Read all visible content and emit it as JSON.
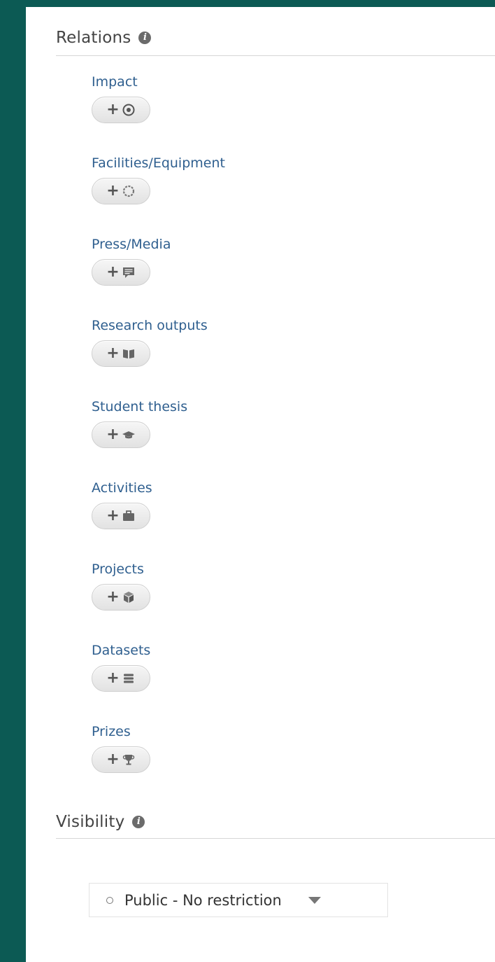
{
  "relations": {
    "title": "Relations",
    "items": [
      {
        "label": "Impact",
        "icon": "target-icon"
      },
      {
        "label": "Facilities/Equipment",
        "icon": "gear-ring-icon"
      },
      {
        "label": "Press/Media",
        "icon": "speech-bubble-icon"
      },
      {
        "label": "Research outputs",
        "icon": "open-book-icon"
      },
      {
        "label": "Student thesis",
        "icon": "graduation-cap-icon"
      },
      {
        "label": "Activities",
        "icon": "briefcase-icon"
      },
      {
        "label": "Projects",
        "icon": "cube-icon"
      },
      {
        "label": "Datasets",
        "icon": "database-icon"
      },
      {
        "label": "Prizes",
        "icon": "trophy-icon"
      }
    ],
    "add_symbol": "+"
  },
  "visibility": {
    "title": "Visibility",
    "selected": "Public - No restriction"
  },
  "colors": {
    "background": "#0c5a54",
    "link": "#2f5f8f"
  }
}
